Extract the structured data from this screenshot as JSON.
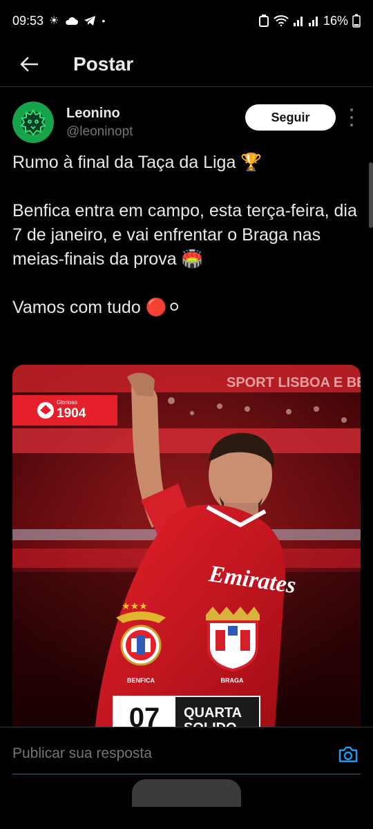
{
  "status_bar": {
    "time": "09:53",
    "battery": "16%"
  },
  "header": {
    "title": "Postar"
  },
  "author": {
    "display_name": "Leonino",
    "handle": "@leoninopt",
    "follow_label": "Seguir"
  },
  "tweet": {
    "line1": "Rumo à final da Taça da Liga 🏆",
    "paragraph2": "Benfica entra em campo, esta terça-feira, dia 7 de janeiro, e vai enfrentar o Braga nas meias-finais da prova 🏟️",
    "paragraph3": "Vamos com tudo 🔴⚪"
  },
  "media": {
    "badge_small": "Glorioso",
    "badge_year": "1904",
    "team_home": "BENFICA",
    "team_away": "BRAGA",
    "match_day": "07",
    "weekday": "QUARTA",
    "weekday_partial": "SOLIDO",
    "sponsor": "Emirates",
    "stadium_board": "SPORT LISBOA E BENFICA"
  },
  "reply": {
    "placeholder": "Publicar sua resposta"
  },
  "colors": {
    "background": "#000000",
    "text": "#e7e9ea",
    "muted": "#71767b",
    "accent": "#1d9bf0",
    "benfica_red": "#e30613"
  },
  "icons": {
    "back": "arrow-left-icon",
    "more": "more-vertical-icon",
    "camera": "camera-icon"
  }
}
